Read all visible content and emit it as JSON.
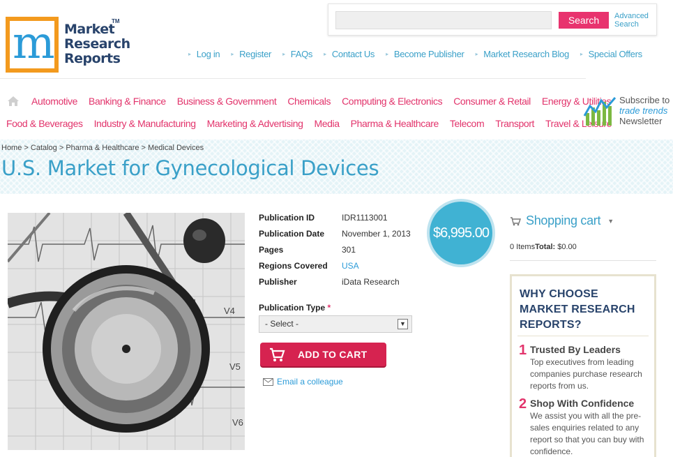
{
  "logo": {
    "line1": "Market",
    "line2": "Research",
    "line3": "Reports",
    "tm": "TM"
  },
  "search": {
    "placeholder": "",
    "button": "Search",
    "advanced_line1": "Advanced",
    "advanced_line2": "Search"
  },
  "toplinks": [
    "Log in",
    "Register",
    "FAQs",
    "Contact Us",
    "Become Publisher",
    "Market Research Blog",
    "Special Offers"
  ],
  "categories_row1": [
    "Automotive",
    "Banking & Finance",
    "Business & Government",
    "Chemicals",
    "Computing & Electronics",
    "Consumer & Retail",
    "Energy & Utilities"
  ],
  "categories_row2": [
    "Food & Beverages",
    "Industry & Manufacturing",
    "Marketing & Advertising",
    "Media",
    "Pharma & Healthcare",
    "Telecom",
    "Transport",
    "Travel & Leisure"
  ],
  "newsletter": {
    "line1": "Subscribe to",
    "line2": "trade trends",
    "line3": "Newsletter"
  },
  "breadcrumb": "Home > Catalog > Pharma & Healthcare > Medical Devices",
  "page_title": "U.S. Market for Gynecological Devices",
  "details": [
    {
      "label": "Publication ID",
      "value": "IDR1113001"
    },
    {
      "label": "Publication Date",
      "value": "November 1, 2013"
    },
    {
      "label": "Pages",
      "value": "301"
    },
    {
      "label": "Regions Covered",
      "value": "USA"
    },
    {
      "label": "Publisher",
      "value": "iData Research"
    }
  ],
  "price": "$6,995.00",
  "publication_type": {
    "label": "Publication Type",
    "required": "*",
    "selected": "- Select -"
  },
  "add_to_cart": "ADD TO CART",
  "email_colleague": "Email a colleague",
  "cart": {
    "title": "Shopping cart",
    "items": "0 Items",
    "total_label": "Total:",
    "total_value": "$0.00"
  },
  "why": {
    "title_line1": "WHY CHOOSE",
    "title_line2": "MARKET RESEARCH",
    "title_line3": "REPORTS?",
    "points": [
      {
        "num": "1",
        "heading": "Trusted By Leaders",
        "text_lines": [
          "Top executives from leading",
          "companies purchase research",
          "reports from us."
        ]
      },
      {
        "num": "2",
        "heading": "Shop With Confidence",
        "text_lines": [
          "We assist you with all the pre-",
          "sales enquiries related to any",
          "report so that you can buy with",
          "confidence."
        ]
      }
    ]
  },
  "colors": {
    "accent_pink": "#e2336b",
    "accent_blue": "#3aa0c8",
    "navy": "#28436b",
    "logo_orange": "#f39a1e"
  },
  "icons": [
    "home-icon",
    "cart-icon",
    "envelope-icon",
    "chevron-down-icon",
    "newsletter-chart-icon",
    "arrow-bullet-icon"
  ]
}
